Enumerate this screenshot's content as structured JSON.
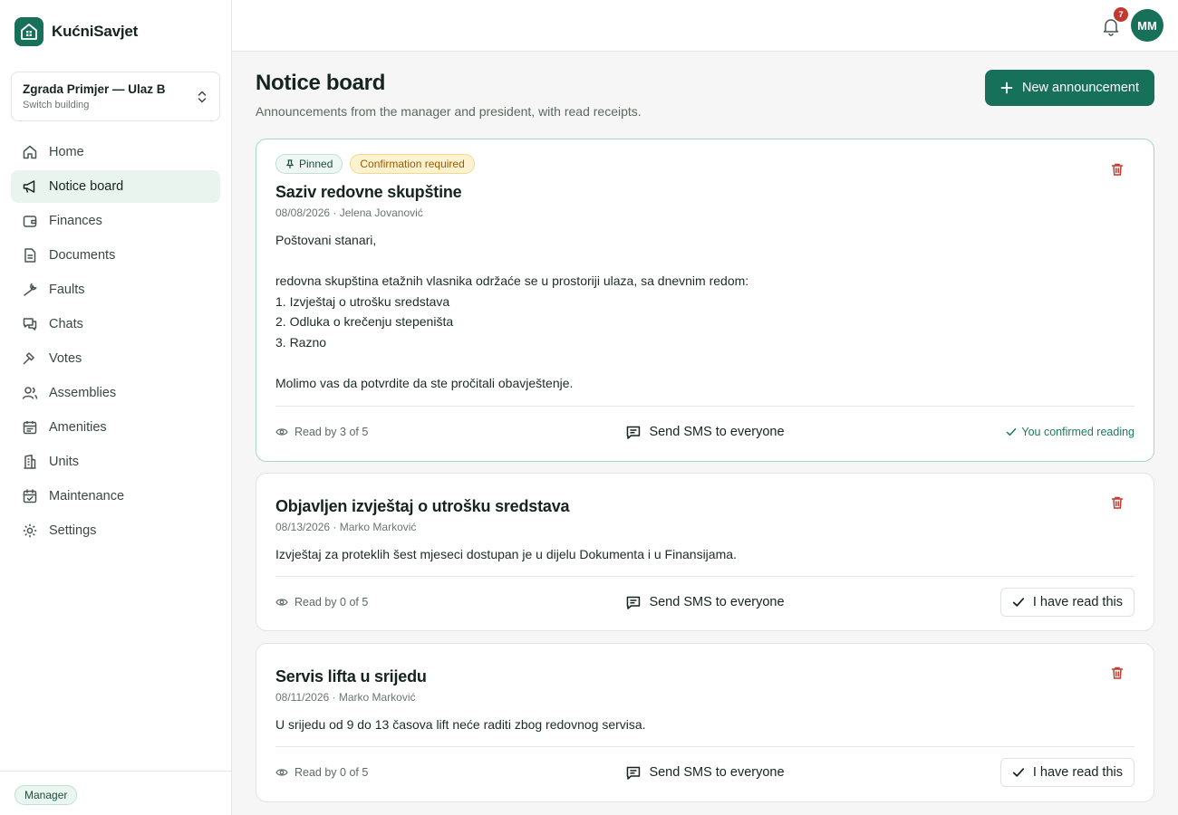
{
  "app": {
    "name": "KućniSavjet"
  },
  "building": {
    "name": "Zgrada Primjer — Ulaz B",
    "sub": "Switch building"
  },
  "nav": [
    {
      "label": "Home",
      "icon": "home-icon"
    },
    {
      "label": "Notice board",
      "icon": "megaphone-icon"
    },
    {
      "label": "Finances",
      "icon": "wallet-icon"
    },
    {
      "label": "Documents",
      "icon": "document-icon"
    },
    {
      "label": "Faults",
      "icon": "wrench-icon"
    },
    {
      "label": "Chats",
      "icon": "chat-icon"
    },
    {
      "label": "Votes",
      "icon": "gavel-icon"
    },
    {
      "label": "Assemblies",
      "icon": "users-icon"
    },
    {
      "label": "Amenities",
      "icon": "calendar-icon"
    },
    {
      "label": "Units",
      "icon": "building-icon"
    },
    {
      "label": "Maintenance",
      "icon": "calendar-check-icon"
    },
    {
      "label": "Settings",
      "icon": "gear-icon"
    }
  ],
  "active_nav": "Notice board",
  "role": "Manager",
  "topbar": {
    "notifications": "7",
    "avatar_initials": "MM"
  },
  "page": {
    "title": "Notice board",
    "subtitle": "Announcements from the manager and president, with read receipts.",
    "new_button": "New announcement"
  },
  "announcements": [
    {
      "pinned_label": "Pinned",
      "confirm_label": "Confirmation required",
      "title": "Saziv redovne skupštine",
      "meta": "08/08/2026 · Jelena Jovanović",
      "body": "Poštovani stanari,\n\nredovna skupština etažnih vlasnika održaće se u prostoriji ulaza, sa dnevnim redom:\n1. Izvještaj o utrošku sredstava\n2. Odluka o krečenju stepeništa\n3. Razno\n\nMolimo vas da potvrdite da ste pročitali obavještenje.",
      "read": "Read by 3 of 5",
      "sms": "Send SMS to everyone",
      "status": "You confirmed reading"
    },
    {
      "title": "Objavljen izvještaj o utrošku sredstava",
      "meta": "08/13/2026 · Marko Marković",
      "body": "Izvještaj za proteklih šest mjeseci dostupan je u dijelu Dokumenta i u Finansijama.",
      "read": "Read by 0 of 5",
      "sms": "Send SMS to everyone",
      "action": "I have read this"
    },
    {
      "title": "Servis lifta u srijedu",
      "meta": "08/11/2026 · Marko Marković",
      "body": "U srijedu od 9 do 13 časova lift neće raditi zbog redovnog servisa.",
      "read": "Read by 0 of 5",
      "sms": "Send SMS to everyone",
      "action": "I have read this"
    }
  ],
  "colors": {
    "brand": "#17705a",
    "danger": "#c23a2b",
    "warning_bg": "#fdf2cf"
  }
}
